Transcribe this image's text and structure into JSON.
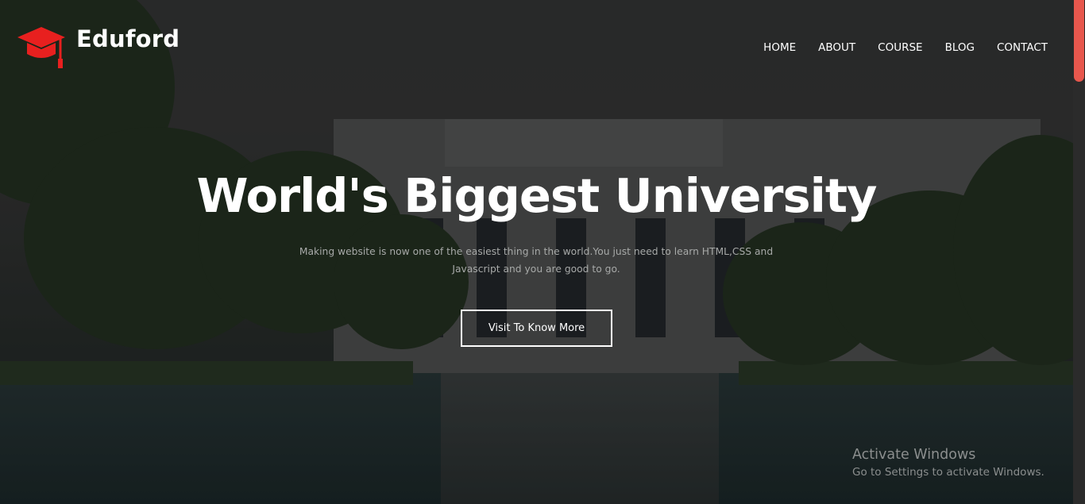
{
  "brand": {
    "name": "Eduford",
    "icon": "graduation-cap-icon",
    "icon_color": "#e8201f"
  },
  "nav": {
    "items": [
      {
        "label": "HOME"
      },
      {
        "label": "ABOUT"
      },
      {
        "label": "COURSE"
      },
      {
        "label": "BLOG"
      },
      {
        "label": "CONTACT"
      }
    ]
  },
  "hero": {
    "title": "World's Biggest University",
    "subtitle_line1": "Making website is now one of the easiest thing in the world.You just need to learn HTML,CSS and",
    "subtitle_line2": "Javascript and you are good to go.",
    "cta_label": "Visit To Know More"
  },
  "watermark": {
    "title": "Activate Windows",
    "subtitle": "Go to Settings to activate Windows."
  },
  "colors": {
    "accent": "#e8574d",
    "text": "#ffffff"
  }
}
